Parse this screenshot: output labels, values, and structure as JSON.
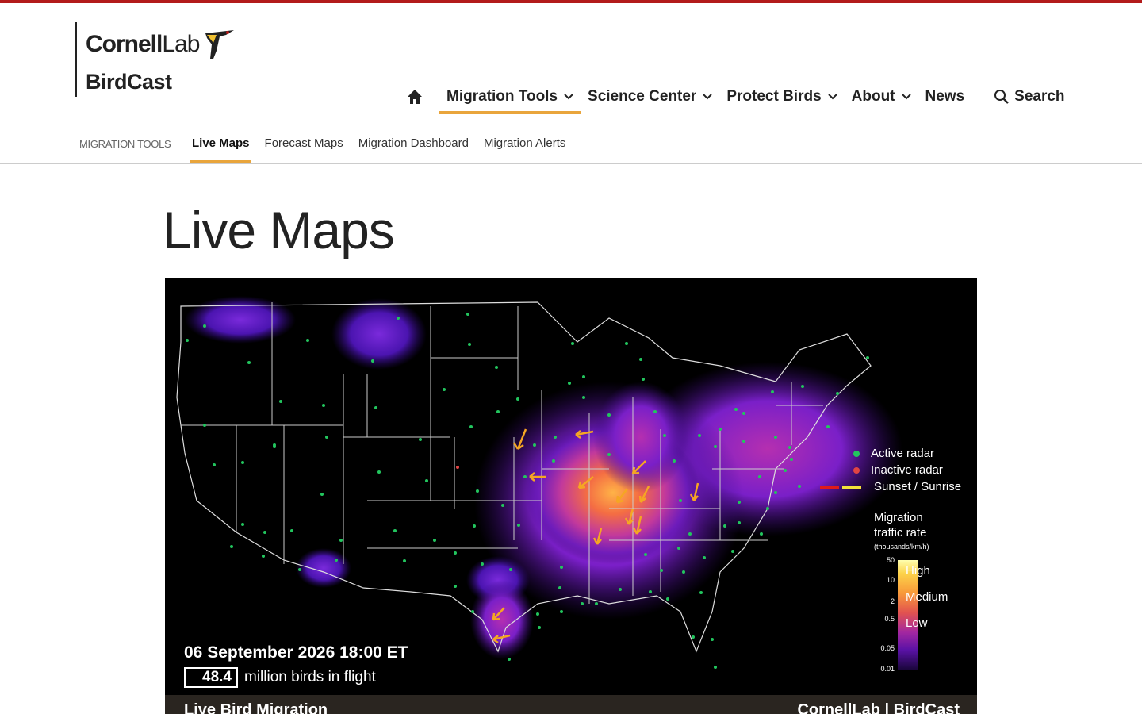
{
  "brand": {
    "cornell": "Cornell",
    "lab": "Lab",
    "product": "BirdCast"
  },
  "nav": {
    "items": [
      {
        "label": "Migration Tools"
      },
      {
        "label": "Science Center"
      },
      {
        "label": "Protect Birds"
      },
      {
        "label": "About"
      },
      {
        "label": "News"
      }
    ],
    "search_label": "Search"
  },
  "subnav": {
    "section_label": "MIGRATION TOOLS",
    "links": [
      {
        "label": "Live Maps"
      },
      {
        "label": "Forecast Maps"
      },
      {
        "label": "Migration Dashboard"
      },
      {
        "label": "Migration Alerts"
      }
    ]
  },
  "page": {
    "title": "Live Maps"
  },
  "map": {
    "legend": {
      "active": "Active radar",
      "inactive": "Inactive radar",
      "sunset": "Sunset / Sunrise",
      "active_color": "#22c55e",
      "inactive_color": "#e04444"
    },
    "rate": {
      "title1": "Migration",
      "title2": "traffic rate",
      "unit": "(thousands/km/h)",
      "ticks": [
        "50",
        "10",
        "2",
        "0.5",
        "0.05",
        "0.01"
      ],
      "high": "High",
      "medium": "Medium",
      "low": "Low"
    },
    "timestamp": "06 September 2026 18:00 ET",
    "count": "48.4",
    "count_suffix": "million birds in flight",
    "banner_left": "Live Bird Migration",
    "banner_right": "CornellLab | BirdCast"
  }
}
